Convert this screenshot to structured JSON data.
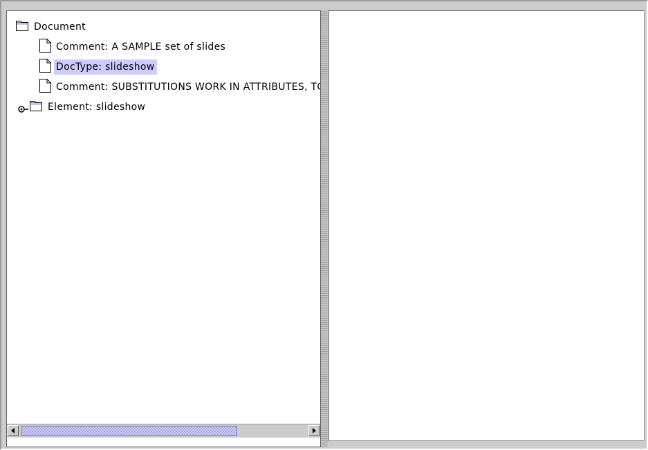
{
  "tree": {
    "nodes": [
      {
        "label": "Document",
        "icon": "folder-icon",
        "selected": false
      },
      {
        "label": "Comment: A SAMPLE set of slides",
        "icon": "document-icon",
        "selected": false
      },
      {
        "label": "DocType: slideshow",
        "icon": "document-icon",
        "selected": true
      },
      {
        "label": "Comment: SUBSTITUTIONS WORK IN ATTRIBUTES, TOO",
        "icon": "document-icon",
        "selected": false
      },
      {
        "label": "Element: slideshow",
        "icon": "folder-icon",
        "selected": false,
        "collapsed": true
      }
    ]
  },
  "scrollbar": {
    "left_arrow": "◀",
    "right_arrow": "▶"
  },
  "colors": {
    "background": "#cccccc",
    "selection": "#ccccff",
    "scroll_thumb": "#aaaadd"
  }
}
